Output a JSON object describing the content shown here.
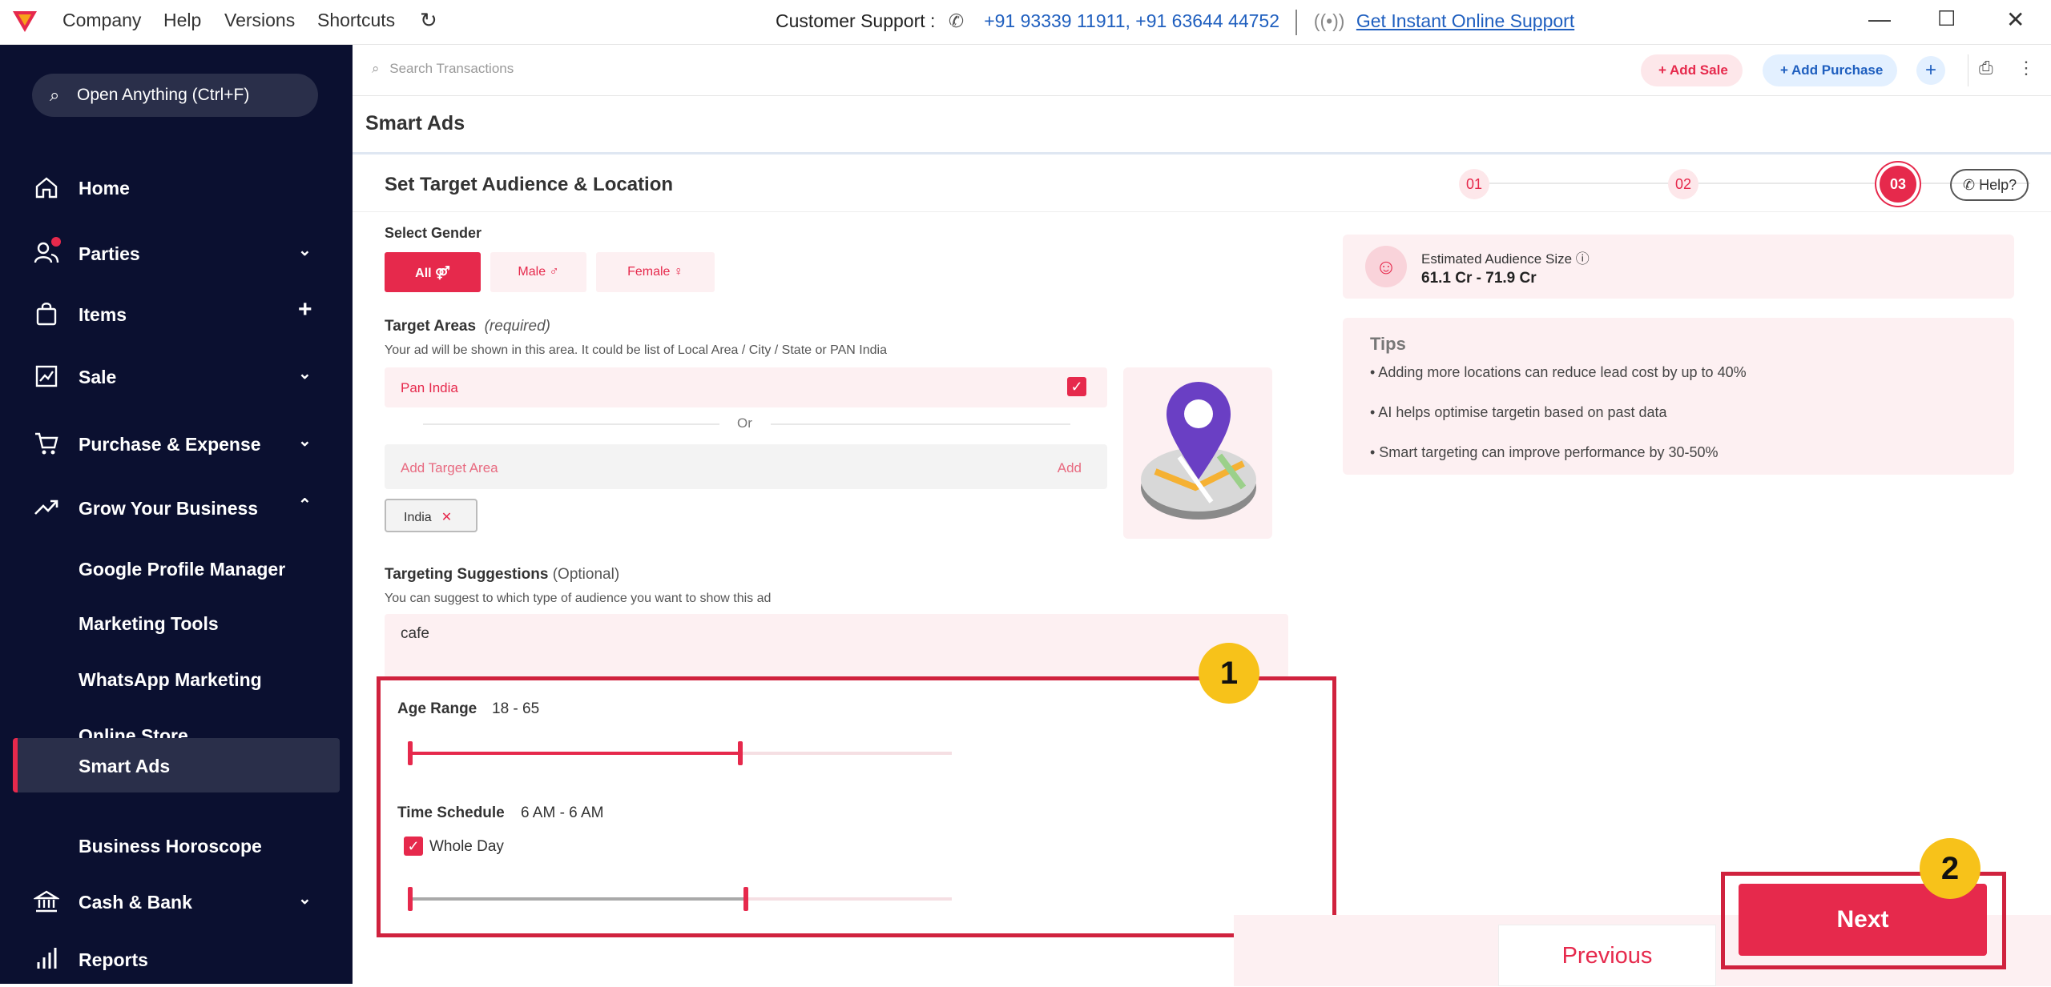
{
  "titlebar": {
    "menu": [
      "Company",
      "Help",
      "Versions",
      "Shortcuts"
    ],
    "support_label": "Customer Support :",
    "support_numbers": "+91 93339 11911, +91 63644 44752",
    "online_support": "Get Instant Online Support"
  },
  "sidebar": {
    "search_placeholder": "Open Anything (Ctrl+F)",
    "items": [
      {
        "label": "Home"
      },
      {
        "label": "Parties"
      },
      {
        "label": "Items"
      },
      {
        "label": "Sale"
      },
      {
        "label": "Purchase & Expense"
      },
      {
        "label": "Grow Your Business"
      },
      {
        "label": "Google Profile Manager"
      },
      {
        "label": "Marketing Tools"
      },
      {
        "label": "WhatsApp Marketing"
      },
      {
        "label": "Online Store"
      },
      {
        "label": "Smart Ads"
      },
      {
        "label": "Business Horoscope"
      },
      {
        "label": "Cash & Bank"
      },
      {
        "label": "Reports"
      }
    ]
  },
  "topbar": {
    "search_placeholder": "Search Transactions",
    "add_sale": "Add Sale",
    "add_purchase": "Add Purchase"
  },
  "page": {
    "title": "Smart Ads",
    "card_title": "Set Target Audience & Location",
    "steps": [
      "01",
      "02",
      "03"
    ],
    "active_step": 3,
    "help": "Help?"
  },
  "form": {
    "gender_label": "Select Gender",
    "gender_options": [
      "All",
      "Male",
      "Female"
    ],
    "gender_selected": "All",
    "target_label": "Target Areas",
    "target_required": "(required)",
    "target_hint": "Your ad will be shown in this area. It could be list of Local Area / City / State or PAN India",
    "pan_india": "Pan India",
    "pan_india_checked": true,
    "or": "Or",
    "add_area_placeholder": "Add Target Area",
    "add_button": "Add",
    "chip": "India",
    "suggest_label": "Targeting Suggestions",
    "suggest_optional": "(Optional)",
    "suggest_hint": "You can suggest to which type of audience you want to show this ad",
    "suggest_value": "cafe",
    "age_label": "Age Range",
    "age_value": "18 - 65",
    "age_min": 18,
    "age_max": 65,
    "age_fill_fraction": 0.61,
    "time_label": "Time Schedule",
    "time_value": "6 AM - 6 AM",
    "whole_day": "Whole Day",
    "whole_day_checked": true,
    "time_fill_fraction": 0.62
  },
  "estimate": {
    "label": "Estimated Audience Size",
    "value": "61.1 Cr - 71.9 Cr"
  },
  "tips": {
    "title": "Tips",
    "items": [
      "• Adding more locations can reduce lead cost by up to 40%",
      "• AI helps optimise targetin based on past data",
      "• Smart targeting can improve performance by 30-50%"
    ]
  },
  "footer": {
    "previous": "Previous",
    "next": "Next"
  },
  "annotations": {
    "badge1": "1",
    "badge2": "2"
  },
  "colors": {
    "accent": "#e6294c",
    "sidebar_bg": "#0b1030",
    "highlight": "#d0223e",
    "badge": "#f7c21a"
  }
}
